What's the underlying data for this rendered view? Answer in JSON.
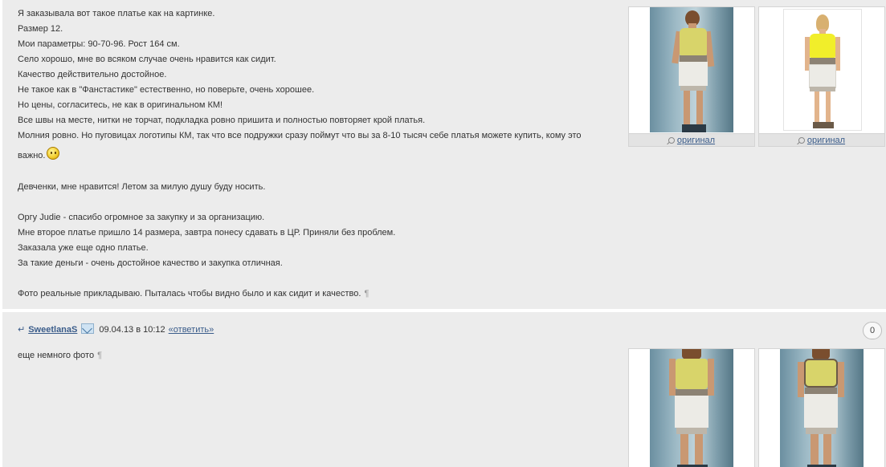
{
  "post1": {
    "lines": [
      "Я заказывала вот такое платье как на картинке.",
      "Размер 12.",
      "Мои параметры: 90-70-96. Рост 164 см.",
      "Село хорошо, мне во всяком случае очень нравится как сидит.",
      "Качество действительно достойное.",
      "Не такое как в \"Фанстастике\" естественно, но поверьте, очень хорошее.",
      "Но цены, согласитесь, не как в оригинальном КМ!",
      "Все швы на месте, нитки не торчат, подкладка ровно пришита и полностью повторяет крой платья.",
      "Молния ровно. Но пуговицах логотипы КМ, так что все подружки сразу поймут что вы за 8-10 тысяч себе платья можете купить, кому это",
      "важно.",
      "Девченки, мне нравится! Летом за милую душу буду носить.",
      "Оргу Judie - спасибо огромное за закупку и за организацию.",
      "Мне второе платье пришло 14 размера, завтра понесу сдавать в ЦР. Приняли без проблем.",
      "Заказала уже еще одно платье.",
      "За такие деньги - очень достойное качество и закупка отличная.",
      "Фото реальные прикладываю. Пыталась чтобы видно было и как сидит и качество."
    ],
    "smiley_icon": "smiley-icon",
    "pilcrow": "¶",
    "thumbs": [
      {
        "caption": "оригинал",
        "icon": "magnifier-icon"
      },
      {
        "caption": "оригинал",
        "icon": "magnifier-icon"
      }
    ]
  },
  "post2": {
    "reply_arrow": "↵",
    "username": "SweetlanaS",
    "mail_icon": "mail-icon",
    "date": "09.04.13 в 10:12",
    "reply_link": "«ответить»",
    "counter": "0",
    "text": "еще немного фото",
    "pilcrow": "¶"
  },
  "colors": {
    "post_background": "#ececec",
    "link": "#3a5c8a",
    "text": "#333333"
  }
}
